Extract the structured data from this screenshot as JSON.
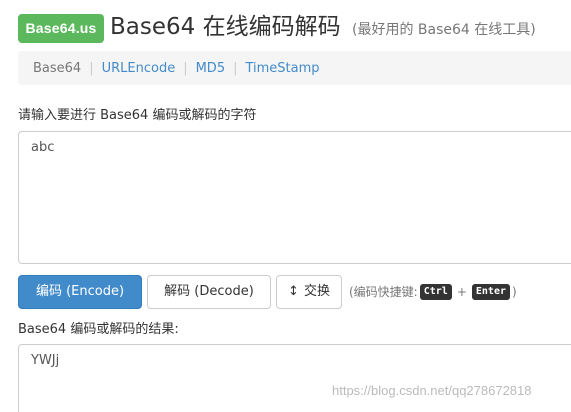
{
  "header": {
    "logo": "Base64.us",
    "title": "Base64 在线编码解码",
    "subtitle": "(最好用的 Base64 在线工具)"
  },
  "nav": {
    "items": [
      {
        "label": "Base64"
      },
      {
        "label": "URLEncode"
      },
      {
        "label": "MD5"
      },
      {
        "label": "TimeStamp"
      }
    ],
    "separator": "|"
  },
  "input": {
    "label": "请输入要进行 Base64 编码或解码的字符",
    "value": "abc"
  },
  "actions": {
    "encode_label": "编码 (Encode)",
    "decode_label": "解码 (Decode)",
    "swap_label": "交换",
    "swap_icon": "↕",
    "shortcut_prefix": "(编码快捷键:",
    "shortcut_key1": "Ctrl",
    "shortcut_plus": "+",
    "shortcut_key2": "Enter",
    "shortcut_suffix": ")"
  },
  "output": {
    "label": "Base64 编码或解码的结果:",
    "value": "YWJj"
  },
  "watermark": "https://blog.csdn.net/qq278672818",
  "colors": {
    "logo_bg": "#5cb85c",
    "primary_button": "#428bca",
    "link": "#428bca",
    "nav_bg": "#f5f5f5"
  }
}
